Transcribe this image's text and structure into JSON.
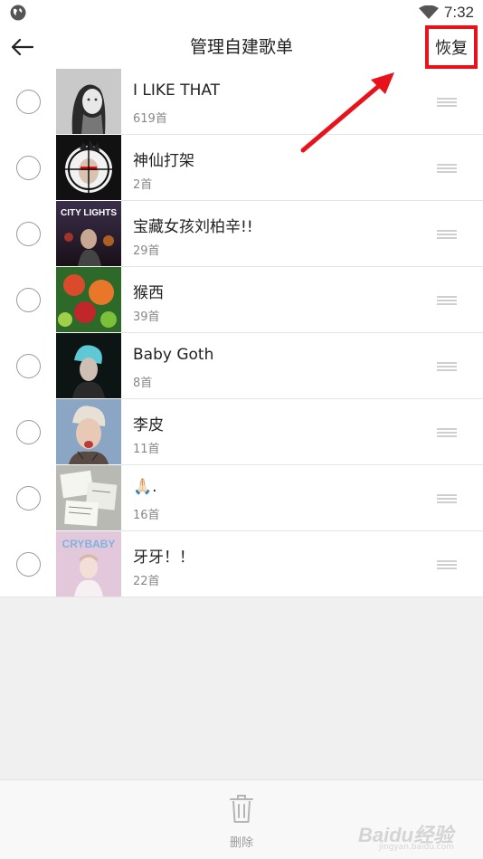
{
  "status_bar": {
    "time": "7:32",
    "left_icon": "globe-icon",
    "wifi_icon": "wifi-icon"
  },
  "header": {
    "title": "管理自建歌单",
    "back_icon": "back-arrow-icon",
    "restore_label": "恢复",
    "highlight_color": "#e8121b"
  },
  "playlists": [
    {
      "name": "I LIKE THAT",
      "count": "619首",
      "cover": "portrait-sketch"
    },
    {
      "name": "神仙打架",
      "count": "2首",
      "cover": "target-face"
    },
    {
      "name": "宝藏女孩刘柏辛!!",
      "count": "29首",
      "cover": "city-lights"
    },
    {
      "name": "猴西",
      "count": "39首",
      "cover": "flowers"
    },
    {
      "name": "Baby Goth",
      "count": "8首",
      "cover": "dark-portrait"
    },
    {
      "name": "李皮",
      "count": "11首",
      "cover": "tattoo-face"
    },
    {
      "name": "🙏🏻.",
      "count": "16首",
      "cover": "papers"
    },
    {
      "name": "牙牙！！",
      "count": "22首",
      "cover": "crybaby"
    }
  ],
  "cover_text": {
    "city_lights": "CITY LIGHTS",
    "crybaby": "CRYBABY"
  },
  "bottom_bar": {
    "delete_label": "删除",
    "delete_icon": "trash-icon"
  },
  "watermark": {
    "main": "Baidu经验",
    "sub": "jingyan.baidu.com"
  }
}
